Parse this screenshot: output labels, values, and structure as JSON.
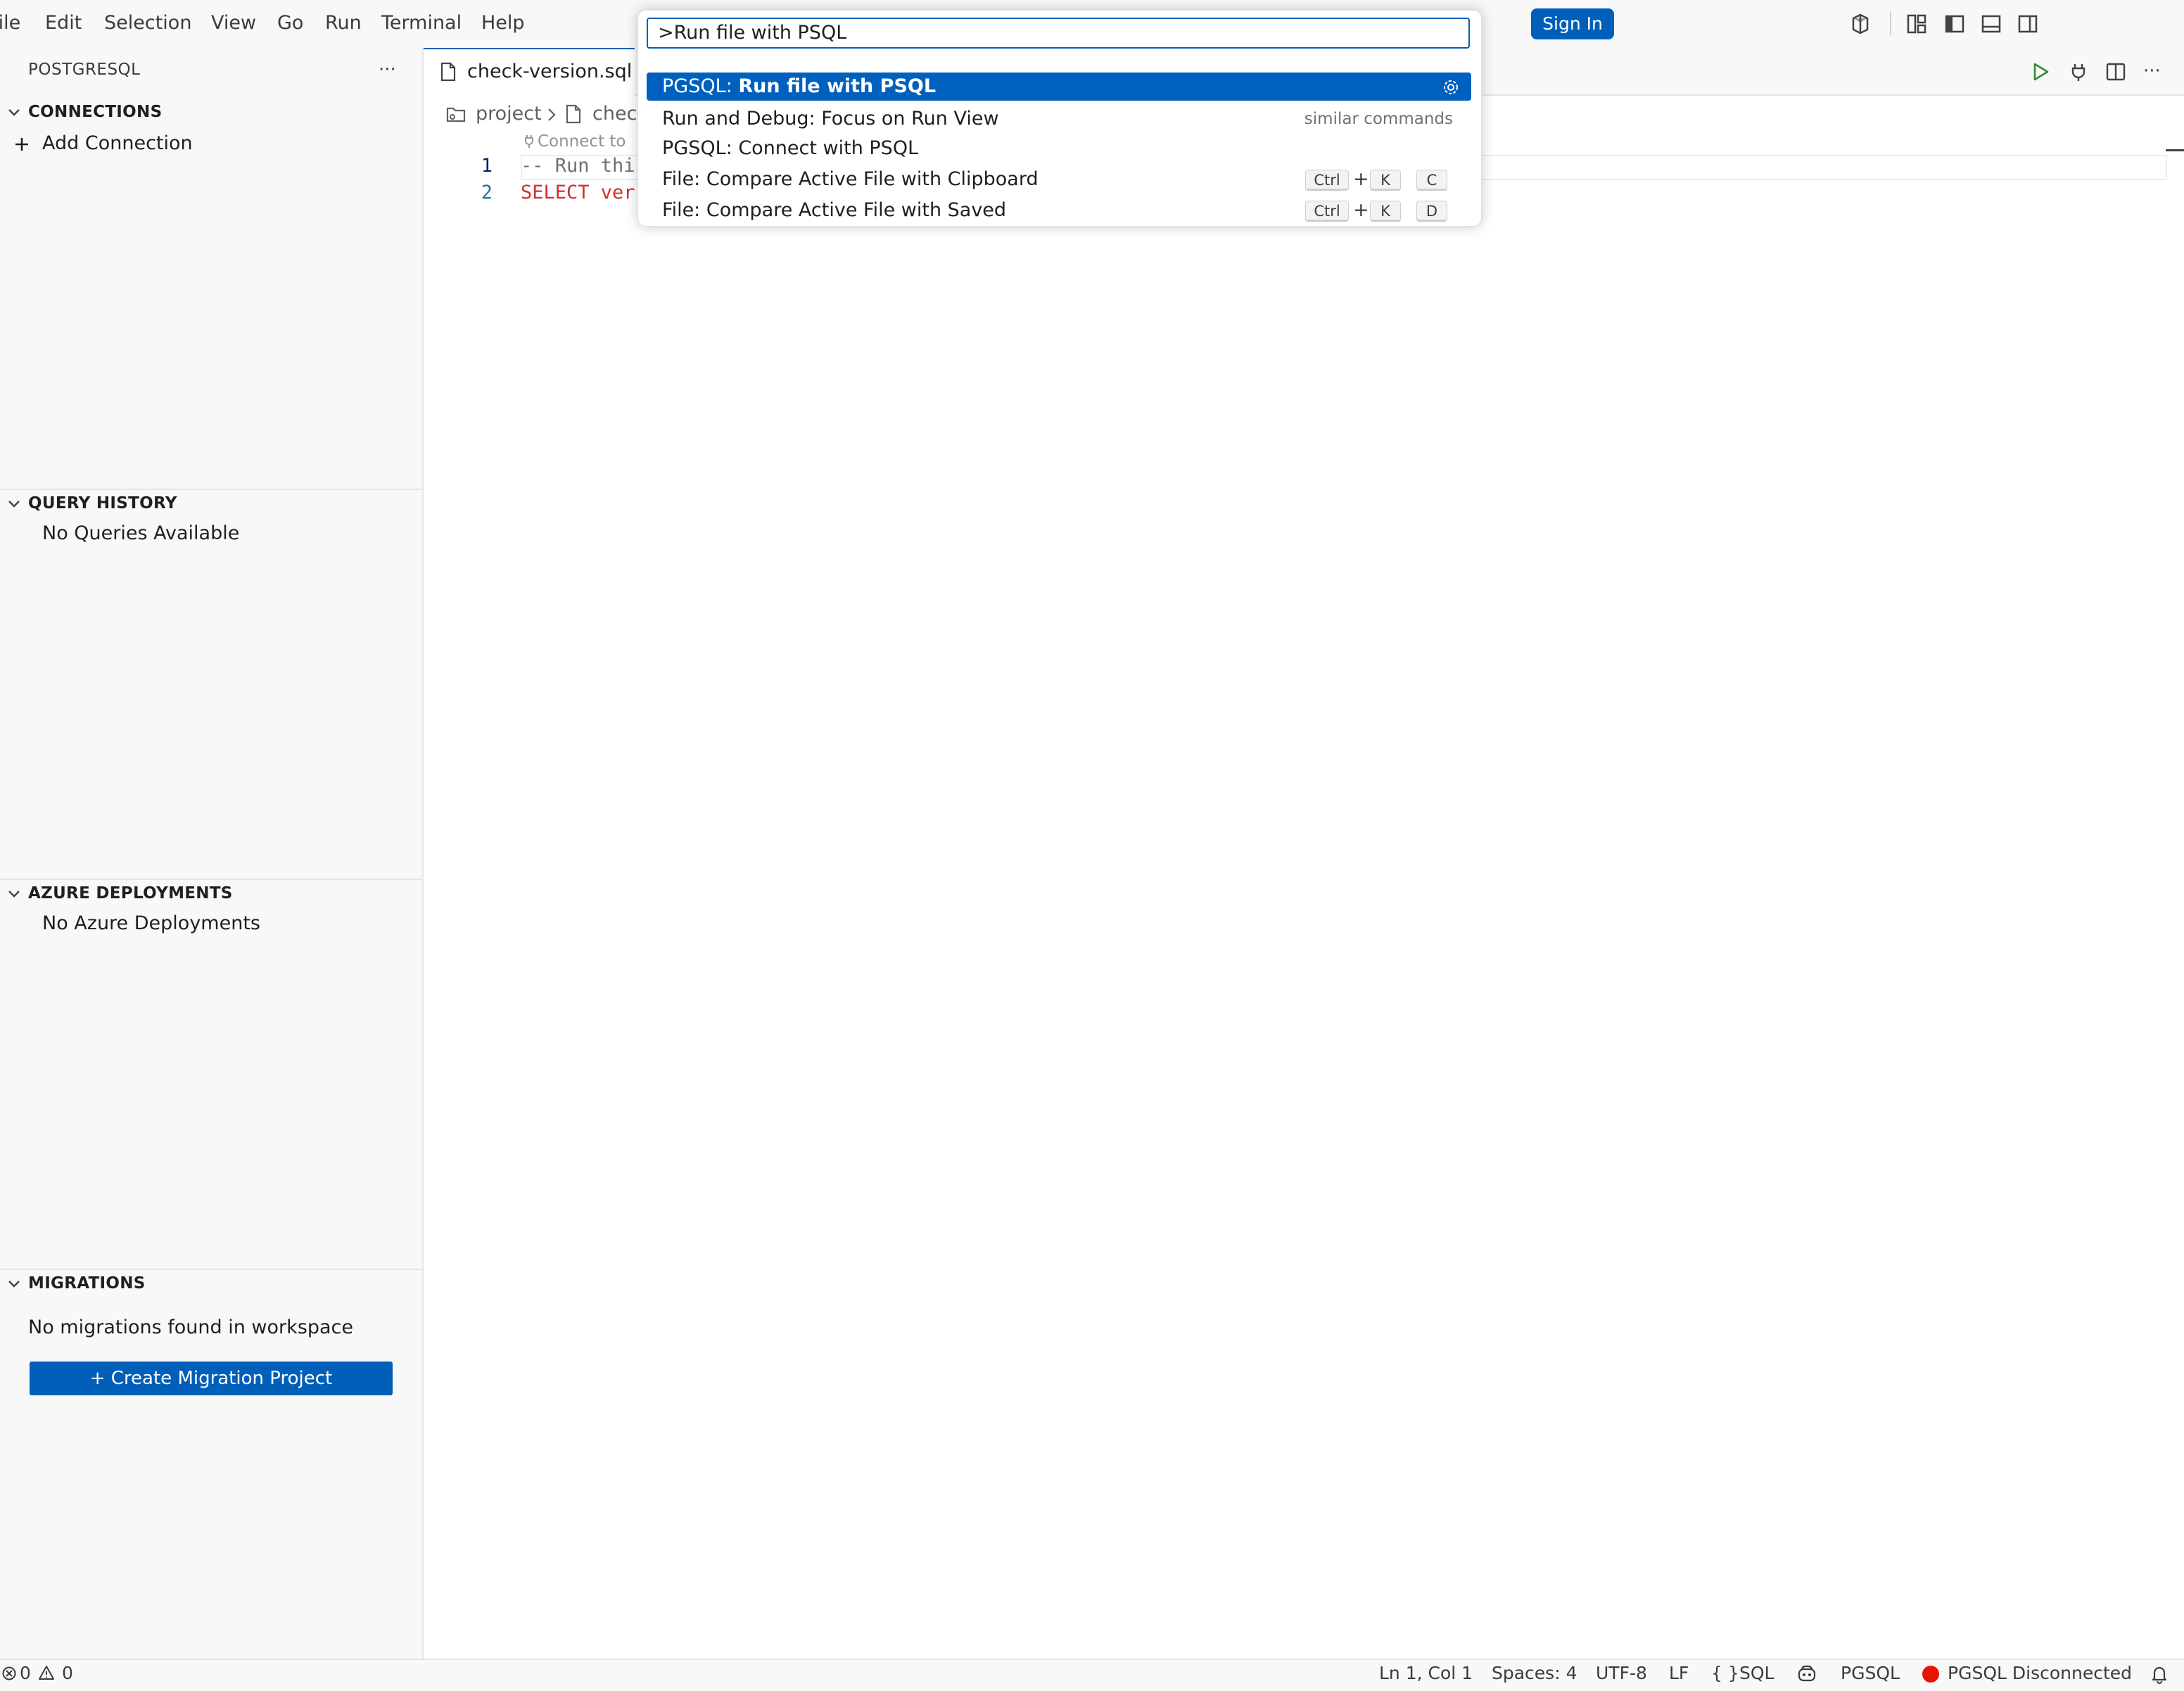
{
  "menu": {
    "file": "File",
    "edit": "Edit",
    "selection": "Selection",
    "view": "View",
    "go": "Go",
    "run": "Run",
    "terminal": "Terminal",
    "help": "Help"
  },
  "titlebar": {
    "sign_in": "Sign In"
  },
  "sidebar": {
    "title": "POSTGRESQL",
    "more": "···",
    "connections": {
      "header": "CONNECTIONS",
      "add": "Add Connection"
    },
    "query_history": {
      "header": "QUERY HISTORY",
      "empty": "No Queries Available"
    },
    "azure": {
      "header": "AZURE DEPLOYMENTS",
      "empty": "No Azure Deployments"
    },
    "migrations": {
      "header": "MIGRATIONS",
      "empty": "No migrations found in workspace",
      "create": "+ Create Migration Project"
    }
  },
  "editor": {
    "tab": "check-version.sql",
    "breadcrumb": {
      "folder": "project",
      "file": "chec"
    },
    "codelens": "Connect to",
    "lines": [
      {
        "num": "1",
        "text": "-- Run thi",
        "color": "#717171"
      },
      {
        "num": "2",
        "text": "SELECT ver",
        "color": "#cd3131"
      }
    ]
  },
  "palette": {
    "query": ">Run file with PSQL",
    "items": [
      {
        "prefix": "PGSQL: ",
        "label": "Run file with PSQL"
      },
      {
        "label": "Run and Debug: Focus on Run View",
        "hint": "similar commands"
      },
      {
        "label": "PGSQL: Connect with PSQL"
      },
      {
        "label": "File: Compare Active File with Clipboard",
        "keys": [
          "Ctrl",
          "+",
          "K",
          "C"
        ]
      },
      {
        "label": "File: Compare Active File with Saved",
        "keys": [
          "Ctrl",
          "+",
          "K",
          "D"
        ]
      }
    ]
  },
  "status": {
    "errors": "0",
    "warnings": "0",
    "position": "Ln 1, Col 1",
    "spaces": "Spaces: 4",
    "encoding": "UTF-8",
    "eol": "LF",
    "language": "SQL",
    "pgsql": "PGSQL",
    "connection": "PGSQL Disconnected"
  },
  "colors": {
    "accent": "#005fb8",
    "selection": "#0060c0",
    "error": "#e51400"
  }
}
